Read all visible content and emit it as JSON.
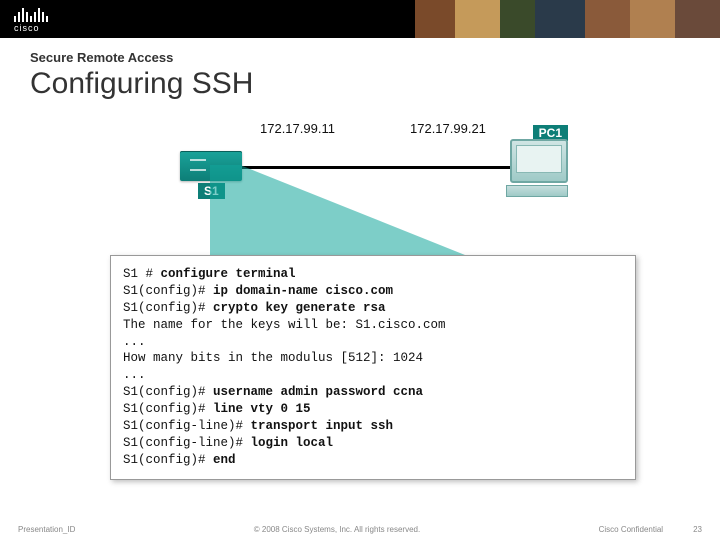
{
  "header": {
    "logo_text": "cisco"
  },
  "title": {
    "kicker": "Secure Remote Access",
    "main": "Configuring SSH"
  },
  "network": {
    "switch_label": "S1",
    "switch_ip": "172.17.99.11",
    "pc_label": "PC1",
    "pc_ip": "172.17.99.21"
  },
  "terminal": {
    "lines": [
      {
        "prompt": "S1 # ",
        "cmd": "configure terminal"
      },
      {
        "prompt": "S1(config)# ",
        "cmd": "ip domain-name cisco.com"
      },
      {
        "prompt": "S1(config)# ",
        "cmd": "crypto key generate rsa"
      },
      {
        "text": "The name for the keys will be: S1.cisco.com"
      },
      {
        "text": "..."
      },
      {
        "text": "How many bits in the modulus [512]: 1024"
      },
      {
        "text": "..."
      },
      {
        "prompt": "S1(config)# ",
        "cmd": "username admin password ccna"
      },
      {
        "prompt": "S1(config)# ",
        "cmd": "line vty 0 15"
      },
      {
        "prompt": "S1(config-line)# ",
        "cmd": "transport input ssh"
      },
      {
        "prompt": "S1(config-line)# ",
        "cmd": "login local"
      },
      {
        "prompt": "S1(config)# ",
        "cmd": "end"
      }
    ]
  },
  "footer": {
    "left": "Presentation_ID",
    "center": "© 2008 Cisco Systems, Inc. All rights reserved.",
    "confidential": "Cisco Confidential",
    "page": "23"
  }
}
